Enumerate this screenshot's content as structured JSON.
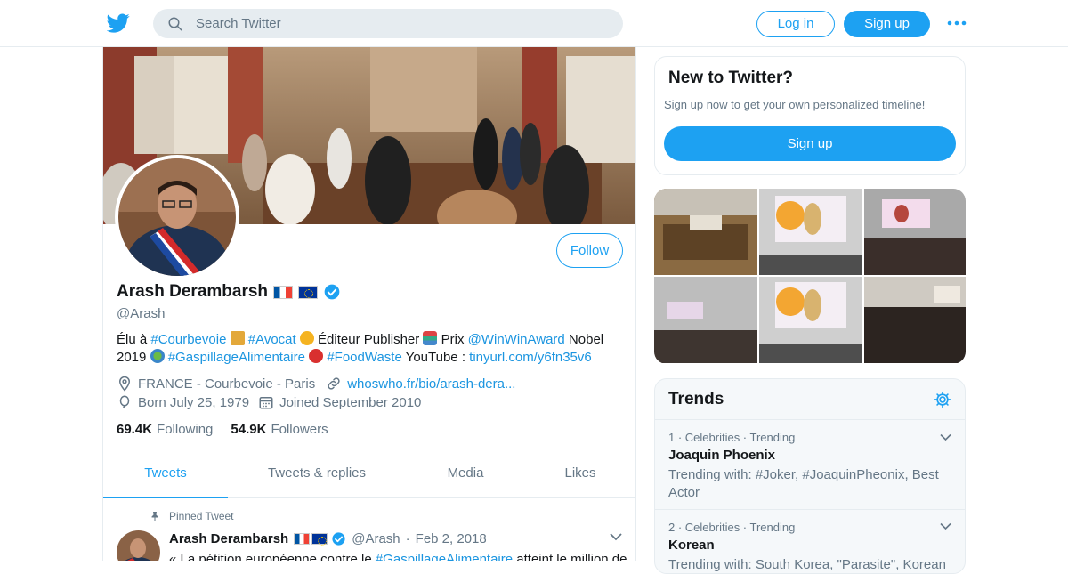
{
  "topbar": {
    "search_placeholder": "Search Twitter",
    "login": "Log in",
    "signup": "Sign up"
  },
  "profile": {
    "follow": "Follow",
    "name": "Arash Derambarsh",
    "handle": "@Arash",
    "bio": {
      "p1": "Élu à ",
      "tag1": "#Courbevoie",
      "p2": " ",
      "tag2": "#Avocat",
      "p3": " Éditeur Publisher ",
      "p4": " Prix ",
      "tag3": "@WinWinAward",
      "p5": " Nobel 2019 ",
      "tag4": "#GaspillageAlimentaire",
      "tag5": "#FoodWaste",
      "p6": " YouTube : ",
      "link": "tinyurl.com/y6fn35v6"
    },
    "location": "FRANCE - Courbevoie - Paris",
    "website": "whoswho.fr/bio/arash-dera...",
    "born": "Born July 25, 1979",
    "joined": "Joined September 2010",
    "following_count": "69.4K",
    "following_label": "Following",
    "followers_count": "54.9K",
    "followers_label": "Followers"
  },
  "tabs": [
    "Tweets",
    "Tweets & replies",
    "Media",
    "Likes"
  ],
  "pinned": {
    "label": "Pinned Tweet",
    "name": "Arash Derambarsh",
    "handle": "@Arash",
    "sep": "·",
    "date": "Feb 2, 2018",
    "text_prefix": "« La pétition européenne contre le ",
    "text_tag": "#GaspillageAlimentaire",
    "text_suffix": " atteint le million de"
  },
  "sidebar": {
    "new_title": "New to Twitter?",
    "new_text": "Sign up now to get your own personalized timeline!",
    "new_button": "Sign up"
  },
  "trends": {
    "title": "Trends",
    "items": [
      {
        "meta": "1 · Celebrities · Trending",
        "title": "Joaquin Phoenix",
        "sub": "Trending with: #Joker, #JoaquinPheonix, Best Actor"
      },
      {
        "meta": "2 · Celebrities · Trending",
        "title": "Korean",
        "sub": "Trending with: South Korea, \"Parasite\", Korean"
      }
    ]
  },
  "colors": {
    "accent": "#1da1f2",
    "link": "#1b95e0",
    "muted": "#657786"
  }
}
